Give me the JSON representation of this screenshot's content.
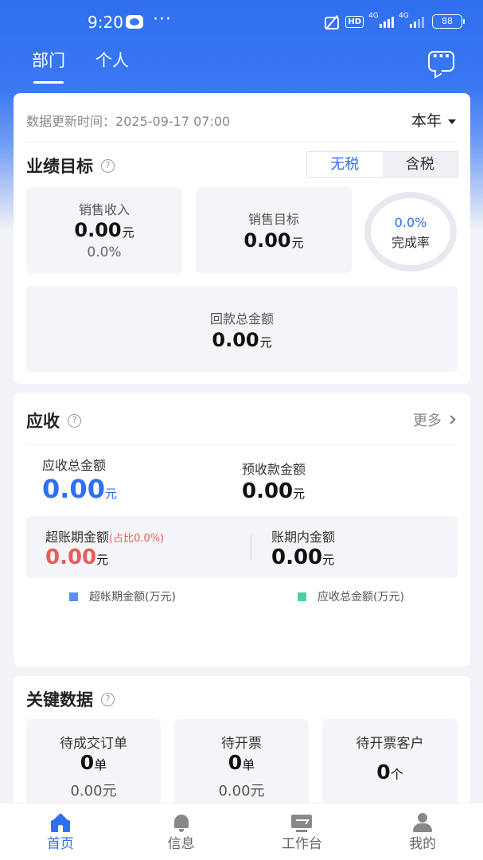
{
  "status_bar": {
    "time": "9:20",
    "dots": "···",
    "hd_label": "HD",
    "net1": "4G",
    "net2": "4G",
    "battery": "88"
  },
  "top_tabs": [
    {
      "label": "部门",
      "active": true
    },
    {
      "label": "个人",
      "active": false
    }
  ],
  "performance": {
    "update_label": "数据更新时间：",
    "update_time": "2025-09-17 07:00",
    "period": "本年",
    "title": "业绩目标",
    "tax_options": [
      "无税",
      "含税"
    ],
    "tax_selected": "无税",
    "sales_income": {
      "label": "销售收入",
      "value": "0.00",
      "unit": "元",
      "pct": "0.0%"
    },
    "sales_target": {
      "label": "销售目标",
      "value": "0.00",
      "unit": "元"
    },
    "completion": {
      "value": "0.0%",
      "label": "完成率"
    },
    "payment_total": {
      "label": "回款总金额",
      "value": "0.00",
      "unit": "元"
    }
  },
  "receivables": {
    "title": "应收",
    "more": "更多",
    "total": {
      "label": "应收总金额",
      "value": "0.00",
      "unit": "元"
    },
    "prepaid": {
      "label": "预收款金额",
      "value": "0.00",
      "unit": "元"
    },
    "overdue": {
      "label": "超账期金额",
      "ratio": "(占比0.0%)",
      "value": "0.00",
      "unit": "元"
    },
    "in_term": {
      "label": "账期内金额",
      "value": "0.00",
      "unit": "元"
    },
    "legend": [
      {
        "label": "超帐期金额(万元)",
        "color": "#5b8ff0"
      },
      {
        "label": "应收总金额(万元)",
        "color": "#4cd3a0"
      }
    ]
  },
  "key_data": {
    "title": "关键数据",
    "items": [
      {
        "label": "待成交订单",
        "value": "0",
        "unit": "单",
        "sub": "0.00元"
      },
      {
        "label": "待开票",
        "value": "0",
        "unit": "单",
        "sub": "0.00元"
      },
      {
        "label": "待开票客户",
        "value": "0",
        "unit": "个",
        "sub": ""
      }
    ]
  },
  "bottom_nav": [
    {
      "label": "首页",
      "icon": "home-icon",
      "active": true
    },
    {
      "label": "信息",
      "icon": "bell-icon",
      "active": false
    },
    {
      "label": "工作台",
      "icon": "workbench-icon",
      "active": false
    },
    {
      "label": "我的",
      "icon": "user-icon",
      "active": false
    }
  ],
  "colors": {
    "primary": "#2f6ff0",
    "danger": "#e85c5c"
  }
}
